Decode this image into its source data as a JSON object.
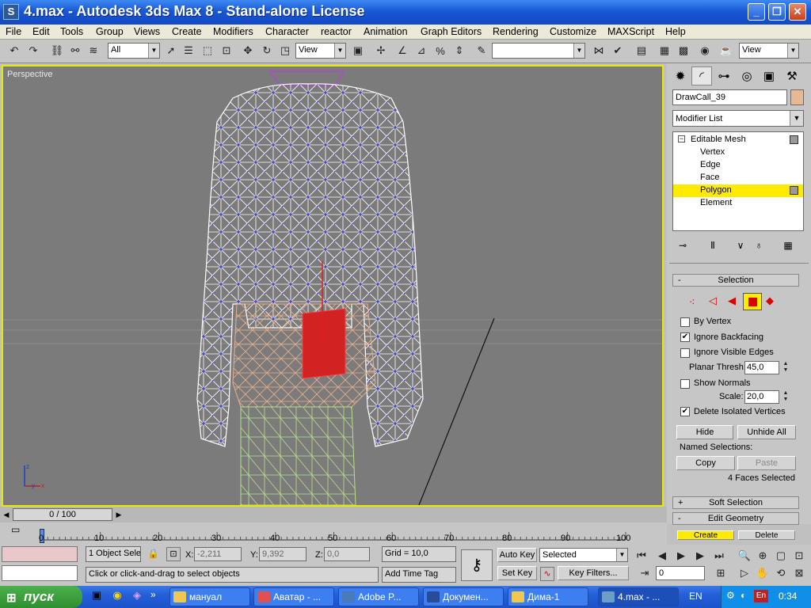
{
  "window": {
    "title": "4.max - Autodesk 3ds Max 8  - Stand-alone License",
    "app_icon": "3ds-max-icon",
    "controls": [
      "minimize-icon",
      "restore-icon",
      "close-icon"
    ]
  },
  "menu": [
    "File",
    "Edit",
    "Tools",
    "Group",
    "Views",
    "Create",
    "Modifiers",
    "Character",
    "reactor",
    "Animation",
    "Graph Editors",
    "Rendering",
    "Customize",
    "MAXScript",
    "Help"
  ],
  "toolbar": {
    "selection_filter": "All",
    "ref_coord": "View",
    "named_selection": "",
    "view_dropdown": "View"
  },
  "viewport": {
    "label": "Perspective"
  },
  "command_panel": {
    "tabs": [
      "create-icon",
      "modify-icon",
      "hierarchy-icon",
      "motion-icon",
      "display-icon",
      "utilities-icon"
    ],
    "object_name": "DrawCall_39",
    "object_color": "#e8b890",
    "modifier_list": "Modifier List",
    "stack": {
      "root": "Editable Mesh",
      "items": [
        "Vertex",
        "Edge",
        "Face",
        "Polygon",
        "Element"
      ],
      "selected": "Polygon"
    },
    "selection_rollout": {
      "title": "Selection",
      "by_vertex": {
        "label": "By Vertex",
        "checked": false
      },
      "ignore_backfacing": {
        "label": "Ignore Backfacing",
        "checked": true
      },
      "ignore_visible_edges": {
        "label": "Ignore Visible Edges",
        "checked": false
      },
      "planar_thresh": {
        "label": "Planar Thresh:",
        "value": "45,0"
      },
      "show_normals": {
        "label": "Show Normals",
        "checked": false
      },
      "scale": {
        "label": "Scale:",
        "value": "20,0"
      },
      "delete_isolated": {
        "label": "Delete Isolated Vertices",
        "checked": true
      },
      "hide": "Hide",
      "unhide_all": "Unhide All",
      "named_selections": "Named Selections:",
      "copy": "Copy",
      "paste": "Paste",
      "status": "4 Faces Selected"
    },
    "soft_selection": "Soft Selection",
    "edit_geometry": "Edit Geometry",
    "create": "Create",
    "delete": "Delete"
  },
  "timeline": {
    "slider": "0 / 100",
    "ticks": [
      "0",
      "10",
      "20",
      "30",
      "40",
      "50",
      "60",
      "70",
      "80",
      "90",
      "100"
    ]
  },
  "status": {
    "objects_selected": "1 Object Sele",
    "x_label": "X:",
    "x": "-2,211",
    "y_label": "Y:",
    "y": "9,392",
    "z_label": "Z:",
    "z": "0,0",
    "grid": "Grid = 10,0",
    "prompt": "Click or click-and-drag to select objects",
    "add_time_tag": "Add Time Tag",
    "auto_key": "Auto Key",
    "set_key": "Set Key",
    "key_mode": "Selected",
    "key_filters": "Key Filters...",
    "frame": "0"
  },
  "taskbar": {
    "start": "пуск",
    "tasks": [
      {
        "label": "мануал",
        "icon": "folder-icon",
        "active": false
      },
      {
        "label": "Аватар - ...",
        "icon": "browser-icon",
        "active": false
      },
      {
        "label": "Adobe P...",
        "icon": "photoshop-icon",
        "active": false
      },
      {
        "label": "Докумен...",
        "icon": "word-icon",
        "active": false
      },
      {
        "label": "Дима-1",
        "icon": "folder-icon",
        "active": false
      },
      {
        "label": "4.max - ...",
        "icon": "3ds-max-icon",
        "active": true
      }
    ],
    "lang": "EN",
    "clock": "0:34",
    "colors": {
      "taskbar": "#245fd8",
      "start": "#2f8f2f",
      "tray": "#0f8fe8"
    }
  }
}
